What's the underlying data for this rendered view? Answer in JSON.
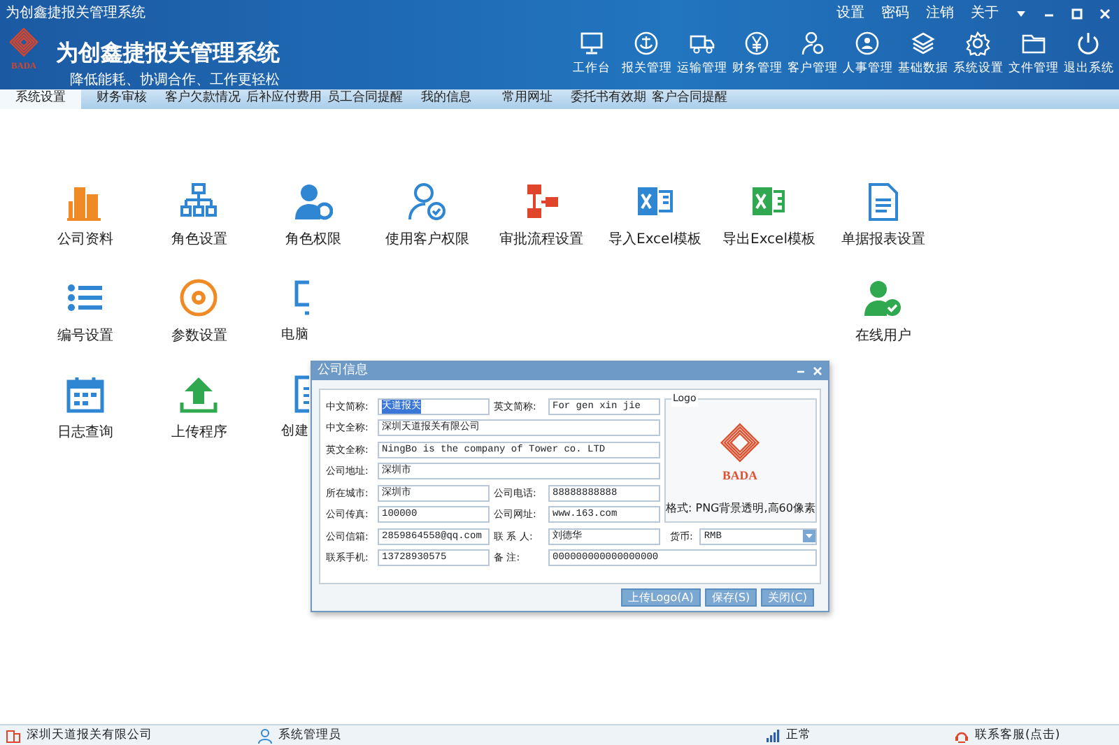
{
  "window": {
    "title": "为创鑫捷报关管理系统"
  },
  "top_links": [
    {
      "label": "设置"
    },
    {
      "label": "密码"
    },
    {
      "label": "注销"
    },
    {
      "label": "关于"
    }
  ],
  "app": {
    "title": "为创鑫捷报关管理系统",
    "slogan": "降低能耗、协调合作、工作更轻松",
    "logo_text": "BADA"
  },
  "nav": [
    {
      "label": "工作台"
    },
    {
      "label": "报关管理"
    },
    {
      "label": "运输管理"
    },
    {
      "label": "财务管理"
    },
    {
      "label": "客户管理"
    },
    {
      "label": "人事管理"
    },
    {
      "label": "基础数据"
    },
    {
      "label": "系统设置"
    },
    {
      "label": "文件管理"
    },
    {
      "label": "退出系统"
    }
  ],
  "tabs": [
    {
      "label": "系统设置",
      "selected": true
    },
    {
      "label": "财务审核",
      "selected": false
    },
    {
      "label": "客户欠款情况",
      "selected": false
    },
    {
      "label": "后补应付费用",
      "selected": false
    },
    {
      "label": "员工合同提醒",
      "selected": false
    },
    {
      "label": "我的信息",
      "selected": false
    },
    {
      "label": "常用网址",
      "selected": false
    },
    {
      "label": "委托书有效期",
      "selected": false
    },
    {
      "label": "客户合同提醒",
      "selected": false
    }
  ],
  "tiles": [
    {
      "label": "公司资料",
      "kind": "full"
    },
    {
      "label": "角色设置",
      "kind": "full"
    },
    {
      "label": "角色权限",
      "kind": "full"
    },
    {
      "label": "使用客户权限",
      "kind": "full"
    },
    {
      "label": "审批流程设置",
      "kind": "full"
    },
    {
      "label": "导入Excel模板",
      "kind": "full"
    },
    {
      "label": "导出Excel模板",
      "kind": "full"
    },
    {
      "label": "单据报表设置",
      "kind": "full"
    },
    {
      "label": "编号设置",
      "kind": "full"
    },
    {
      "label": "参数设置",
      "kind": "full"
    },
    {
      "label": "电脑",
      "kind": "cut"
    },
    {
      "label": "在线用户",
      "kind": "last"
    },
    {
      "label": "日志查询",
      "kind": "full"
    },
    {
      "label": "上传程序",
      "kind": "full"
    },
    {
      "label": "创建",
      "kind": "cut"
    }
  ],
  "dialog": {
    "title": "公司信息",
    "logo_legend": "Logo",
    "logo_text": "BADA",
    "logo_hint": "格式: PNG背景透明,高60像素",
    "fields": [
      {
        "label": "中文简称:",
        "value": "天道报关",
        "kind": "half",
        "text_selected": true
      },
      {
        "label": "英文简称:",
        "value": "For gen xin jie",
        "kind": "half",
        "text_selected": false
      },
      {
        "label": "中文全称:",
        "value": "深圳天道报关有限公司",
        "kind": "full",
        "text_selected": false
      },
      {
        "label": "英文全称:",
        "value": "NingBo is the company of Tower co. LTD",
        "kind": "full",
        "text_selected": false
      },
      {
        "label": "公司地址:",
        "value": "深圳市",
        "kind": "full",
        "text_selected": false
      },
      {
        "label": "所在城市:",
        "value": "深圳市",
        "kind": "half",
        "text_selected": false
      },
      {
        "label": "公司电话:",
        "value": "88888888888",
        "kind": "half",
        "text_selected": false
      },
      {
        "label": "公司传真:",
        "value": "100000",
        "kind": "half",
        "text_selected": false
      },
      {
        "label": "公司网址:",
        "value": "www.163.com",
        "kind": "half",
        "text_selected": false
      },
      {
        "label": "公司信箱:",
        "value": "2859864558@qq.com",
        "kind": "half",
        "text_selected": false
      },
      {
        "label": "联 系 人:",
        "value": "刘德华",
        "kind": "half",
        "text_selected": false
      },
      {
        "label": "货币:",
        "value": "RMB",
        "kind": "select",
        "text_selected": false
      },
      {
        "label": "联系手机:",
        "value": "13728930575",
        "kind": "half",
        "text_selected": false
      },
      {
        "label": "备    注:",
        "value": "000000000000000000",
        "kind": "wide",
        "text_selected": false
      }
    ],
    "buttons": [
      {
        "label": "上传Logo(A)"
      },
      {
        "label": "保存(S)"
      },
      {
        "label": "关闭(C)"
      }
    ]
  },
  "status_bar": [
    {
      "text": "深圳天道报关有限公司"
    },
    {
      "text": "系统管理员"
    },
    {
      "text": "正常"
    },
    {
      "text": "联系客服(点击)"
    }
  ]
}
